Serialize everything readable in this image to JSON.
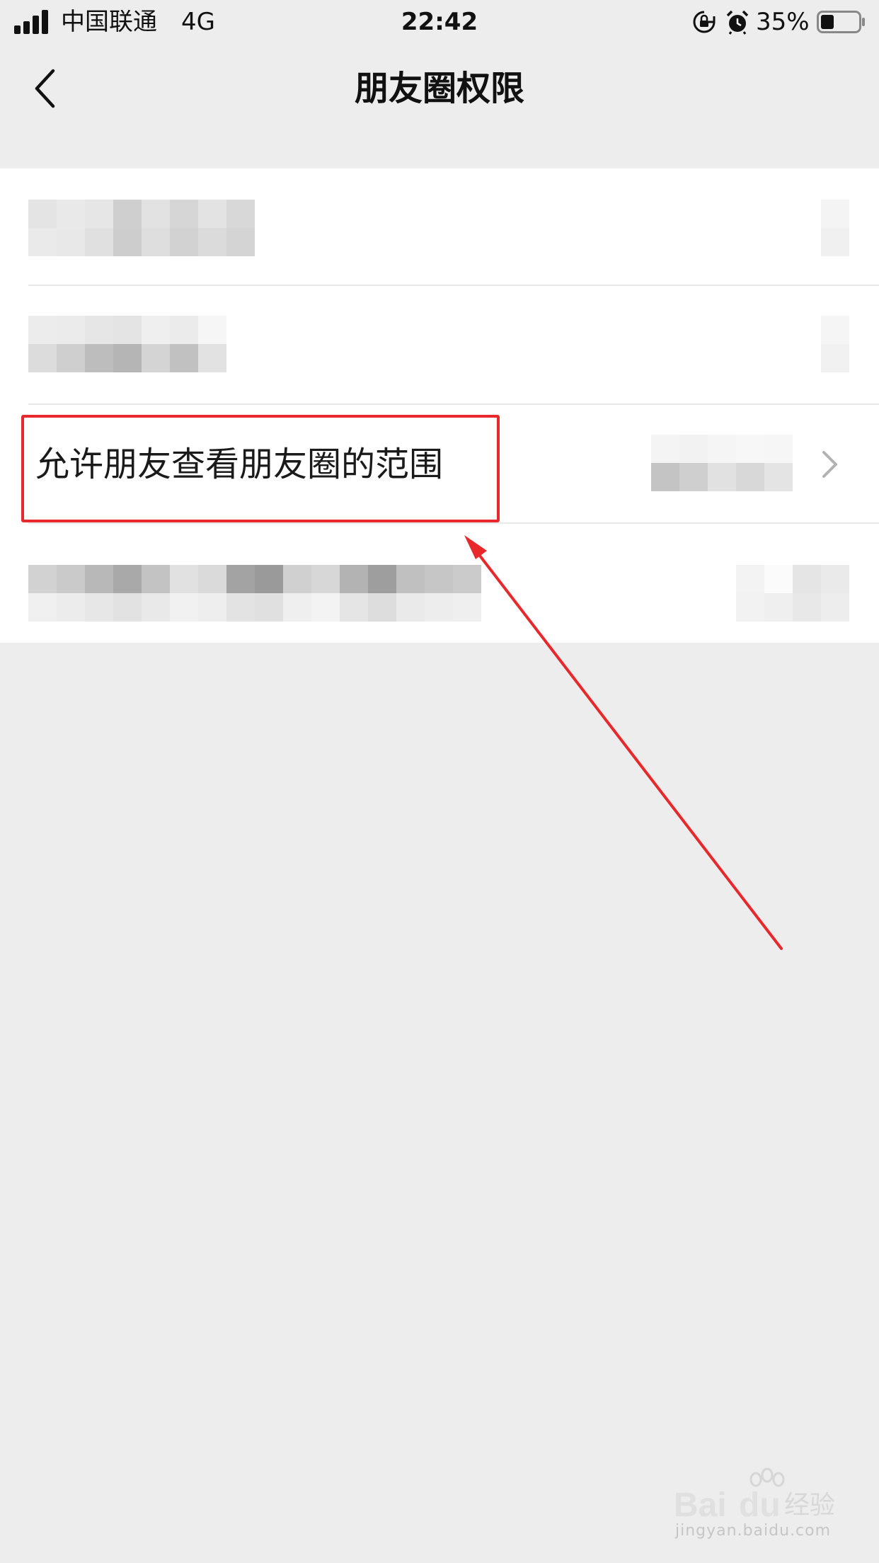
{
  "status_bar": {
    "carrier": "中国联通",
    "network": "4G",
    "time": "22:42",
    "battery_percent": "35%",
    "battery_level": 0.35,
    "icons": [
      "signal-icon",
      "rotation-lock-icon",
      "alarm-icon",
      "battery-icon"
    ]
  },
  "nav": {
    "title": "朋友圈权限",
    "back_icon": "chevron-left-icon"
  },
  "settings": {
    "rows": [
      {
        "label": "",
        "redacted": true,
        "icon": "chevron-right-icon"
      },
      {
        "label": "",
        "redacted": true,
        "icon": "chevron-right-icon"
      },
      {
        "label": "允许朋友查看朋友圈的范围",
        "redacted": false,
        "value_redacted": true,
        "icon": "chevron-right-icon"
      },
      {
        "label": "",
        "redacted": true,
        "icon": "chevron-right-icon"
      }
    ]
  },
  "annotation": {
    "color": "#e8282b",
    "highlighted_row_index": 2
  },
  "watermark": {
    "brand": "Baidu 经验",
    "url": "jingyan.baidu.com"
  },
  "colors": {
    "background": "#ededed",
    "list_background": "#ffffff",
    "annotation_red": "#e8282b",
    "chevron_gray": "#b2b2b2"
  }
}
